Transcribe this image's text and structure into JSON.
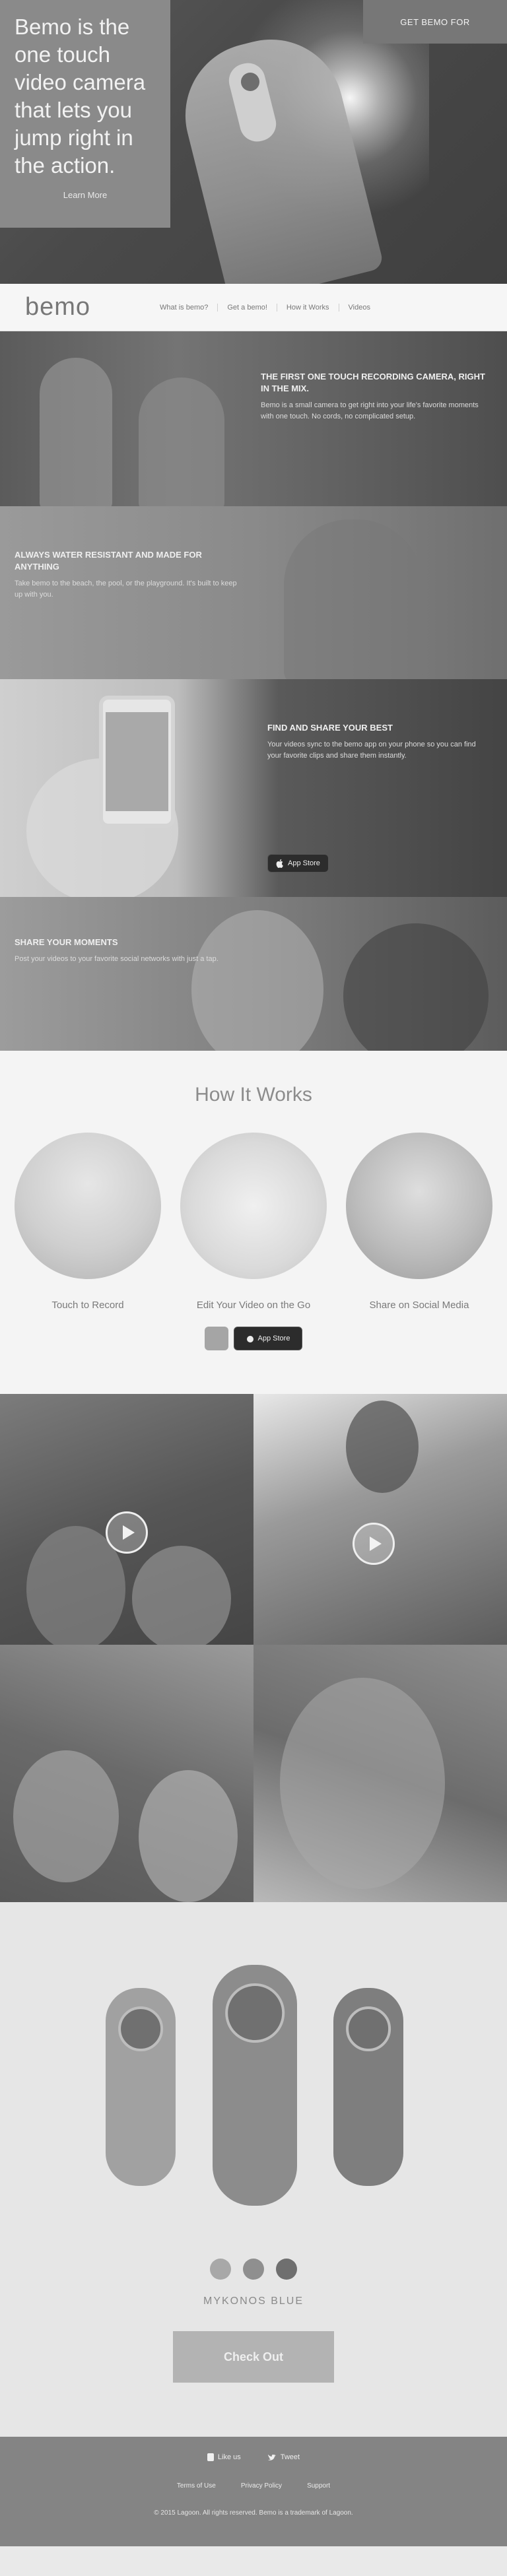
{
  "hero": {
    "title": "Bemo is the one touch video camera that lets you jump right in the action.",
    "link": "Learn More",
    "cta": "GET BEMO FOR"
  },
  "nav": {
    "logo": "bemo",
    "items": [
      "What is bemo?",
      "Get a bemo!",
      "How it Works",
      "Videos"
    ]
  },
  "bands": [
    {
      "heading": "THE FIRST ONE TOUCH RECORDING CAMERA, RIGHT IN THE MIX.",
      "text": "Bemo is a small camera to get right into your life's favorite moments with one touch. No cords, no complicated setup."
    },
    {
      "heading": "ALWAYS WATER RESISTANT AND MADE FOR ANYTHING",
      "text": "Take bemo to the beach, the pool, or the playground. It's built to keep up with you."
    },
    {
      "heading": "FIND AND SHARE YOUR BEST",
      "text": "Your videos sync to the bemo app on your phone so you can find your favorite clips and share them instantly.",
      "badge": "App Store"
    },
    {
      "heading": "SHARE YOUR MOMENTS",
      "text": "Post your videos to your favorite social networks with just a tap."
    }
  ],
  "how": {
    "title": "How It Works",
    "steps": [
      {
        "label": "Touch to Record"
      },
      {
        "label": "Edit Your Video on the Go"
      },
      {
        "label": "Share on Social Media"
      }
    ],
    "badge": "App Store"
  },
  "product": {
    "tags": [
      "",
      "",
      ""
    ],
    "color_name": "MYKONOS BLUE",
    "checkout": "Check Out",
    "swatches": [
      "#a8a8a8",
      "#8f8f8f",
      "#6f6f6f"
    ]
  },
  "footer": {
    "social": [
      "Like us",
      "Tweet"
    ],
    "links": [
      "Terms of Use",
      "Privacy Policy",
      "Support"
    ],
    "copyright": "© 2015 Lagoon. All rights reserved. Bemo is a trademark of Lagoon."
  }
}
